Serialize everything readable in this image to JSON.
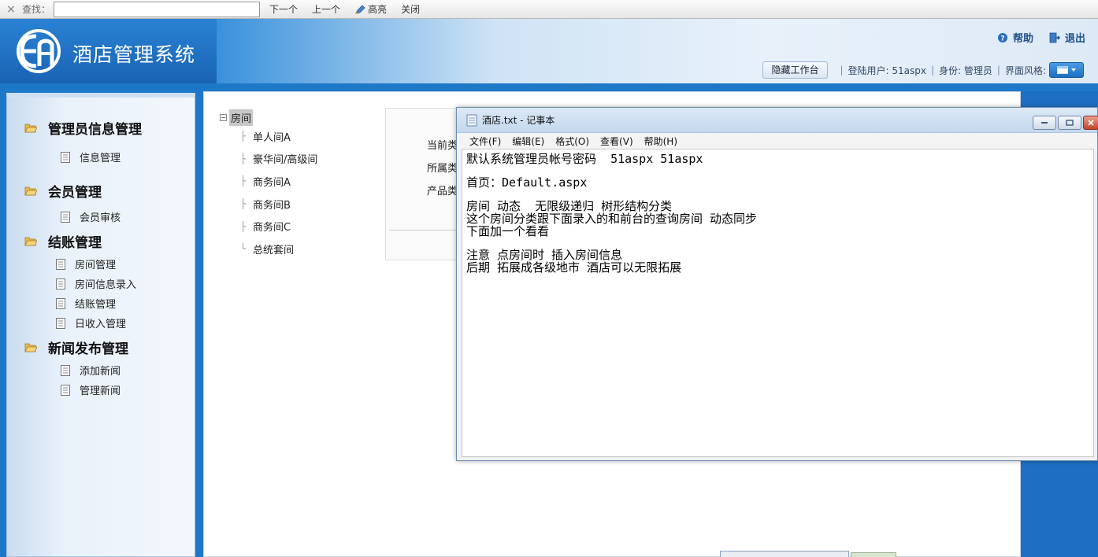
{
  "findbar": {
    "close": "×",
    "label": "查找：",
    "value": "",
    "next": "下一个",
    "prev": "上一个",
    "highlight": "高亮",
    "close_label": "关闭"
  },
  "header": {
    "title": "酒店管理系统",
    "help": "帮助",
    "logout": "退出",
    "hide_workbench": "隐藏工作台",
    "login_user": "登陆用户: 51aspx",
    "role": "身份: 管理员",
    "theme": "界面风格:"
  },
  "sidebar": {
    "groups": [
      {
        "title": "管理员信息管理",
        "items": [
          "信息管理"
        ]
      },
      {
        "title": "会员管理",
        "items": [
          "会员审核"
        ]
      },
      {
        "title": "结账管理",
        "items": [
          "房间管理",
          "房间信息录入",
          "结账管理",
          "日收入管理"
        ]
      },
      {
        "title": "新闻发布管理",
        "items": [
          "添加新闻",
          "管理新闻"
        ]
      }
    ]
  },
  "tree": {
    "root": "房间",
    "nodes": [
      "单人间A",
      "豪华间/高级间",
      "商务间A",
      "商务间B",
      "商务间C",
      "总统套间"
    ]
  },
  "form": {
    "labels": [
      "当前类",
      "所属类",
      "产品类"
    ]
  },
  "notepad": {
    "title": "酒店.txt - 记事本",
    "menu": [
      "文件(F)",
      "编辑(E)",
      "格式(O)",
      "查看(V)",
      "帮助(H)"
    ],
    "lines": [
      "默认系统管理员帐号密码  51aspx 51aspx",
      "",
      "首页：Default.aspx",
      "",
      "房间 动态  无限级递归 树形结构分类",
      "这个房间分类跟下面录入的和前台的查询房间 动态同步",
      "下面加一个看看",
      "",
      "注意 点房间时 插入房间信息",
      "后期 拓展成各级地市 酒店可以无限拓展"
    ]
  },
  "colors": {
    "accent": "#1e78c8",
    "header_blue": "#1a63b3"
  }
}
